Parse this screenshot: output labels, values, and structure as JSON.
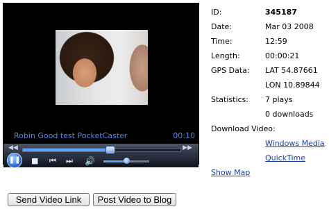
{
  "player": {
    "title": "Robin Good test PocketCaster",
    "time": "00:10",
    "seek_progress": 0.55,
    "volume_level": 0.5,
    "icons": {
      "seek_back": "rewind-icon",
      "seek_forward": "fast-forward-icon",
      "play_pause": "pause-icon",
      "stop": "stop-icon",
      "previous": "skip-previous-icon",
      "next": "skip-next-icon",
      "volume": "speaker-icon"
    }
  },
  "info": {
    "id_label": "ID:",
    "id_value": "345187",
    "date_label": "Date:",
    "date_value": "Mar 03 2008",
    "time_label": "Time:",
    "time_value": "12:59",
    "length_label": "Length:",
    "length_value": "00:00:21",
    "gps_label": "GPS Data:",
    "gps_lat": "LAT 54.87661",
    "gps_lon": "LON 10.89844",
    "stats_label": "Statistics:",
    "stats_plays": "7 plays",
    "stats_downloads": "0 downloads",
    "download_label": "Download Video:",
    "download_wmv": "Windows Media",
    "download_qt": "QuickTime",
    "show_map": "Show Map"
  },
  "buttons": {
    "send_link": "Send Video Link",
    "post_blog": "Post Video to Blog"
  },
  "colors": {
    "player_text": "#4f88e6",
    "link": "#1a3ea8",
    "accent": "#5aa0ff"
  }
}
